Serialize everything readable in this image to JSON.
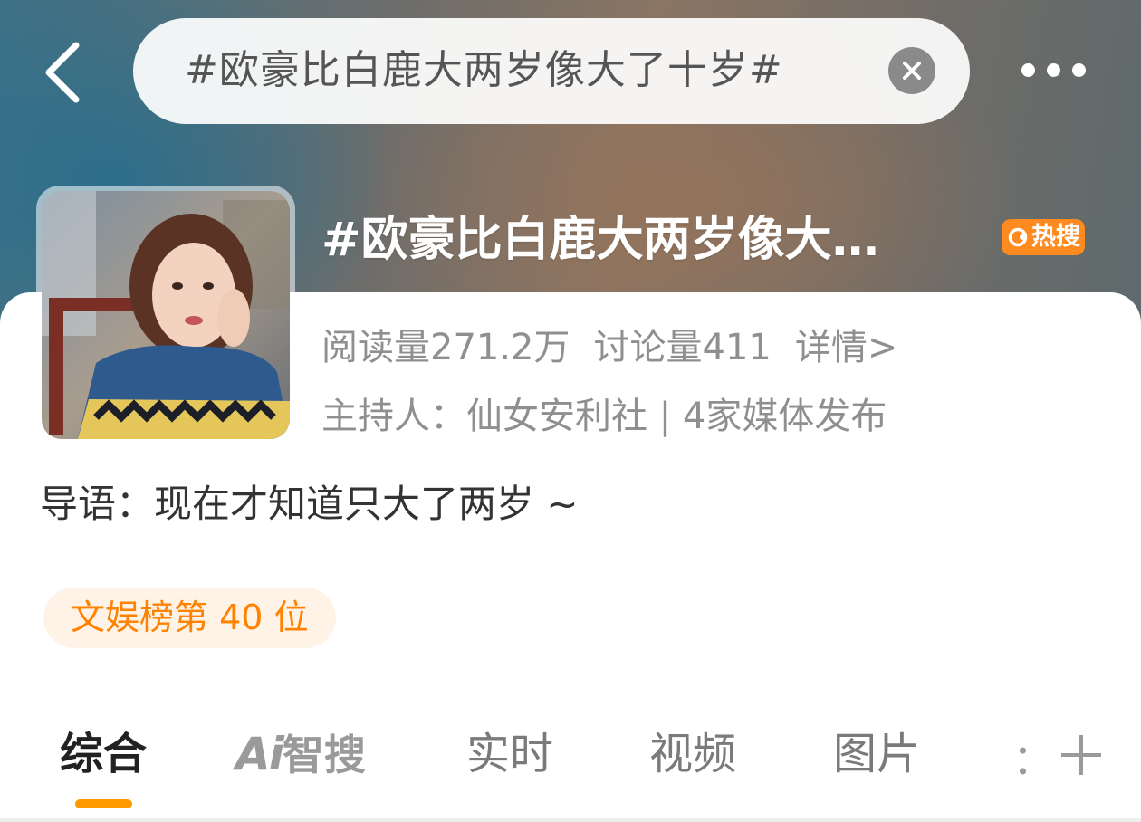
{
  "header": {
    "search_query": "#欧豪比白鹿大两岁像大了十岁#",
    "icons": {
      "back": "chevron-left-icon",
      "clear": "close-circle-icon",
      "more": "more-horizontal-icon"
    }
  },
  "topic": {
    "title": "#欧豪比白鹿大两岁像大…",
    "badge": "热搜",
    "badge_color": "#ff8a1f",
    "read_count": "阅读量271.2万",
    "discussion_count": "讨论量411",
    "details_link": "详情>",
    "host_line": "主持人：仙女安利社 | 4家媒体发布",
    "intro": "导语：现在才知道只大了两岁 ~",
    "rank": "文娱榜第 40 位"
  },
  "tabs": {
    "items": [
      {
        "label": "综合",
        "active": true
      },
      {
        "label": "智搜",
        "prefix": "Ai",
        "active": false
      },
      {
        "label": "实时",
        "active": false
      },
      {
        "label": "视频",
        "active": false
      },
      {
        "label": "图片",
        "active": false
      }
    ],
    "overflow": "：",
    "add_icon": "plus-icon",
    "accent_color": "#ff9a00"
  }
}
